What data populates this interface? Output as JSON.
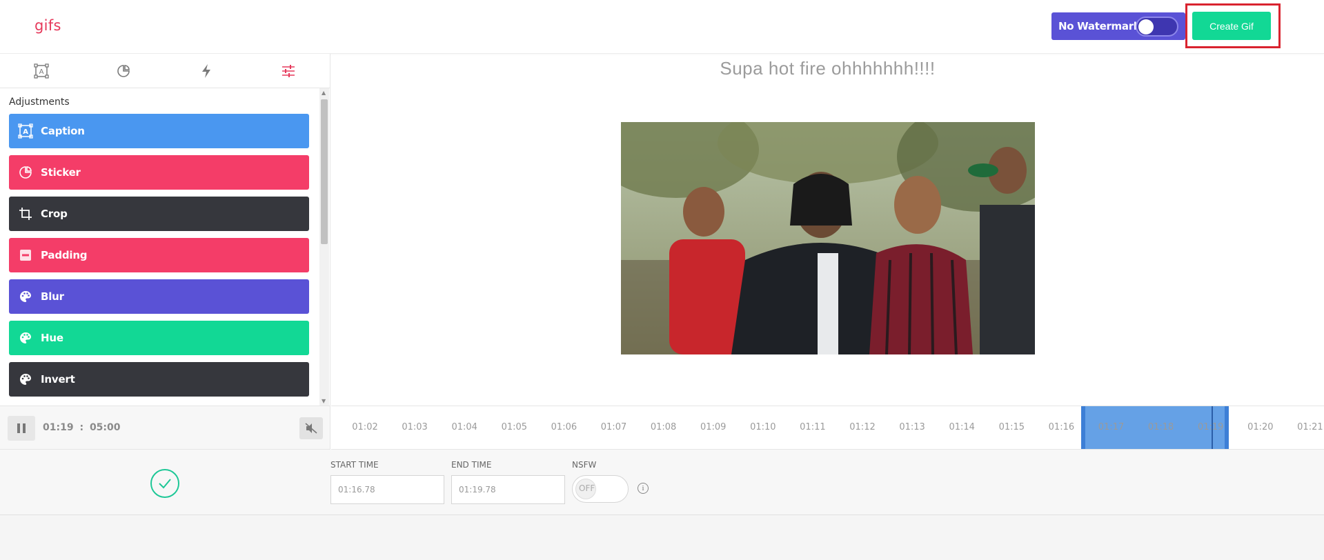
{
  "header": {
    "logo": "gifs",
    "watermark_label": "No Watermark",
    "create_label": "Create Gif"
  },
  "sidebar": {
    "tabs": [
      {
        "icon": "caption-icon"
      },
      {
        "icon": "sticker-icon"
      },
      {
        "icon": "bolt-icon"
      },
      {
        "icon": "sliders-icon",
        "active": true
      }
    ],
    "section_title": "Adjustments",
    "items": [
      {
        "label": "Caption",
        "color": "#4a97f0",
        "icon": "caption-icon"
      },
      {
        "label": "Sticker",
        "color": "#f43d68",
        "icon": "sticker-icon"
      },
      {
        "label": "Crop",
        "color": "#36373d",
        "icon": "crop-icon"
      },
      {
        "label": "Padding",
        "color": "#f43d68",
        "icon": "padding-icon"
      },
      {
        "label": "Blur",
        "color": "#5a52d6",
        "icon": "palette-icon"
      },
      {
        "label": "Hue",
        "color": "#12d895",
        "icon": "palette-icon"
      },
      {
        "label": "Invert",
        "color": "#36373d",
        "icon": "palette-icon"
      }
    ]
  },
  "preview": {
    "title": "Supa hot fire ohhhhhhh!!!!"
  },
  "player": {
    "current_time": "01:19",
    "separator": ":",
    "total_time": "05:00"
  },
  "timeline": {
    "ticks": [
      "01:02",
      "01:03",
      "01:04",
      "01:05",
      "01:06",
      "01:07",
      "01:08",
      "01:09",
      "01:10",
      "01:11",
      "01:12",
      "01:13",
      "01:14",
      "01:15",
      "01:16",
      "01:17",
      "01:18",
      "01:19",
      "01:20",
      "01:21"
    ]
  },
  "controls": {
    "start_label": "START TIME",
    "start_value": "01:16.78",
    "end_label": "END TIME",
    "end_value": "01:19.78",
    "nsfw_label": "NSFW",
    "nsfw_state": "OFF"
  }
}
